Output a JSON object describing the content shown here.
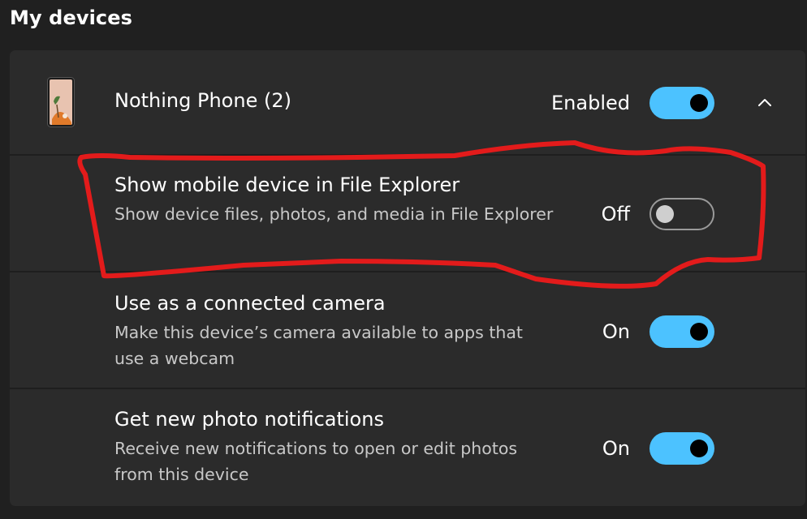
{
  "section": {
    "title": "My devices"
  },
  "device": {
    "name": "Nothing Phone (2)",
    "status_label": "Enabled",
    "enabled": true,
    "expanded": true,
    "icon": "phone-thumbnail",
    "chevron_icon": "chevron-up-icon"
  },
  "settings": [
    {
      "title": "Show mobile device in File Explorer",
      "description": "Show device files, photos, and media in File Explorer",
      "state_label": "Off",
      "on": false
    },
    {
      "title": "Use as a connected camera",
      "description": "Make this device’s camera available to apps that use a webcam",
      "state_label": "On",
      "on": true
    },
    {
      "title": "Get new photo notifications",
      "description": "Receive new notifications to open or edit photos from this device",
      "state_label": "On",
      "on": true
    }
  ],
  "colors": {
    "accent": "#4cc2ff",
    "background": "#202020",
    "card": "#2b2b2b",
    "annotation": "#e31b1b"
  }
}
